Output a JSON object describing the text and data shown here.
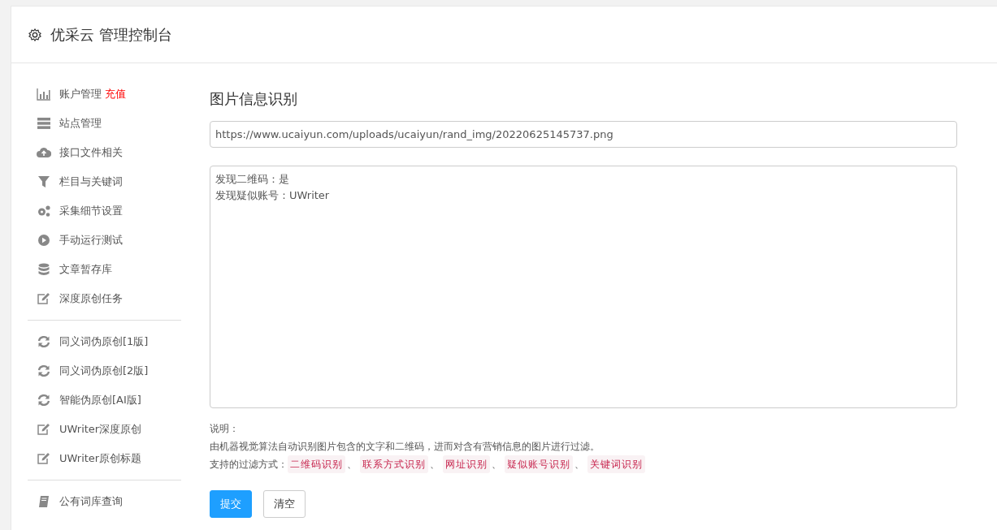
{
  "header": {
    "title": "优采云 管理控制台"
  },
  "sidebar": {
    "groups": [
      {
        "items": [
          {
            "kind": "chart",
            "label": "账户管理",
            "badge": "充值"
          },
          {
            "kind": "server",
            "label": "站点管理"
          },
          {
            "kind": "cloud",
            "label": "接口文件相关"
          },
          {
            "kind": "filter",
            "label": "栏目与关键词"
          },
          {
            "kind": "gears",
            "label": "采集细节设置"
          },
          {
            "kind": "play",
            "label": "手动运行测试"
          },
          {
            "kind": "database",
            "label": "文章暂存库"
          },
          {
            "kind": "edit",
            "label": "深度原创任务"
          }
        ]
      },
      {
        "items": [
          {
            "kind": "refresh",
            "label": "同义词伪原创[1版]"
          },
          {
            "kind": "refresh",
            "label": "同义词伪原创[2版]"
          },
          {
            "kind": "refresh",
            "label": "智能伪原创[AI版]"
          },
          {
            "kind": "edit",
            "label": "UWriter深度原创"
          },
          {
            "kind": "edit",
            "label": "UWriter原创标题"
          }
        ]
      },
      {
        "items": [
          {
            "kind": "book",
            "label": "公有词库查询"
          }
        ]
      }
    ]
  },
  "main": {
    "title": "图片信息识别",
    "url_field": {
      "value": "https://www.ucaiyun.com/uploads/ucaiyun/rand_img/20220625145737.png"
    },
    "result_area": {
      "lines": [
        "发现二维码：是",
        "发现疑似账号：UWriter"
      ]
    },
    "notes": {
      "heading": "说明：",
      "description": "由机器视觉算法自动识别图片包含的文字和二维码，进而对含有营销信息的图片进行过滤。",
      "methods_label": "支持的过滤方式：",
      "methods": [
        "二维码识别",
        "联系方式识别",
        "网址识别",
        "疑似账号识别",
        "关键词识别"
      ],
      "separator": "、"
    },
    "buttons": [
      {
        "kind": "primary",
        "label": "提交"
      },
      {
        "kind": "default",
        "label": "清空"
      }
    ]
  }
}
